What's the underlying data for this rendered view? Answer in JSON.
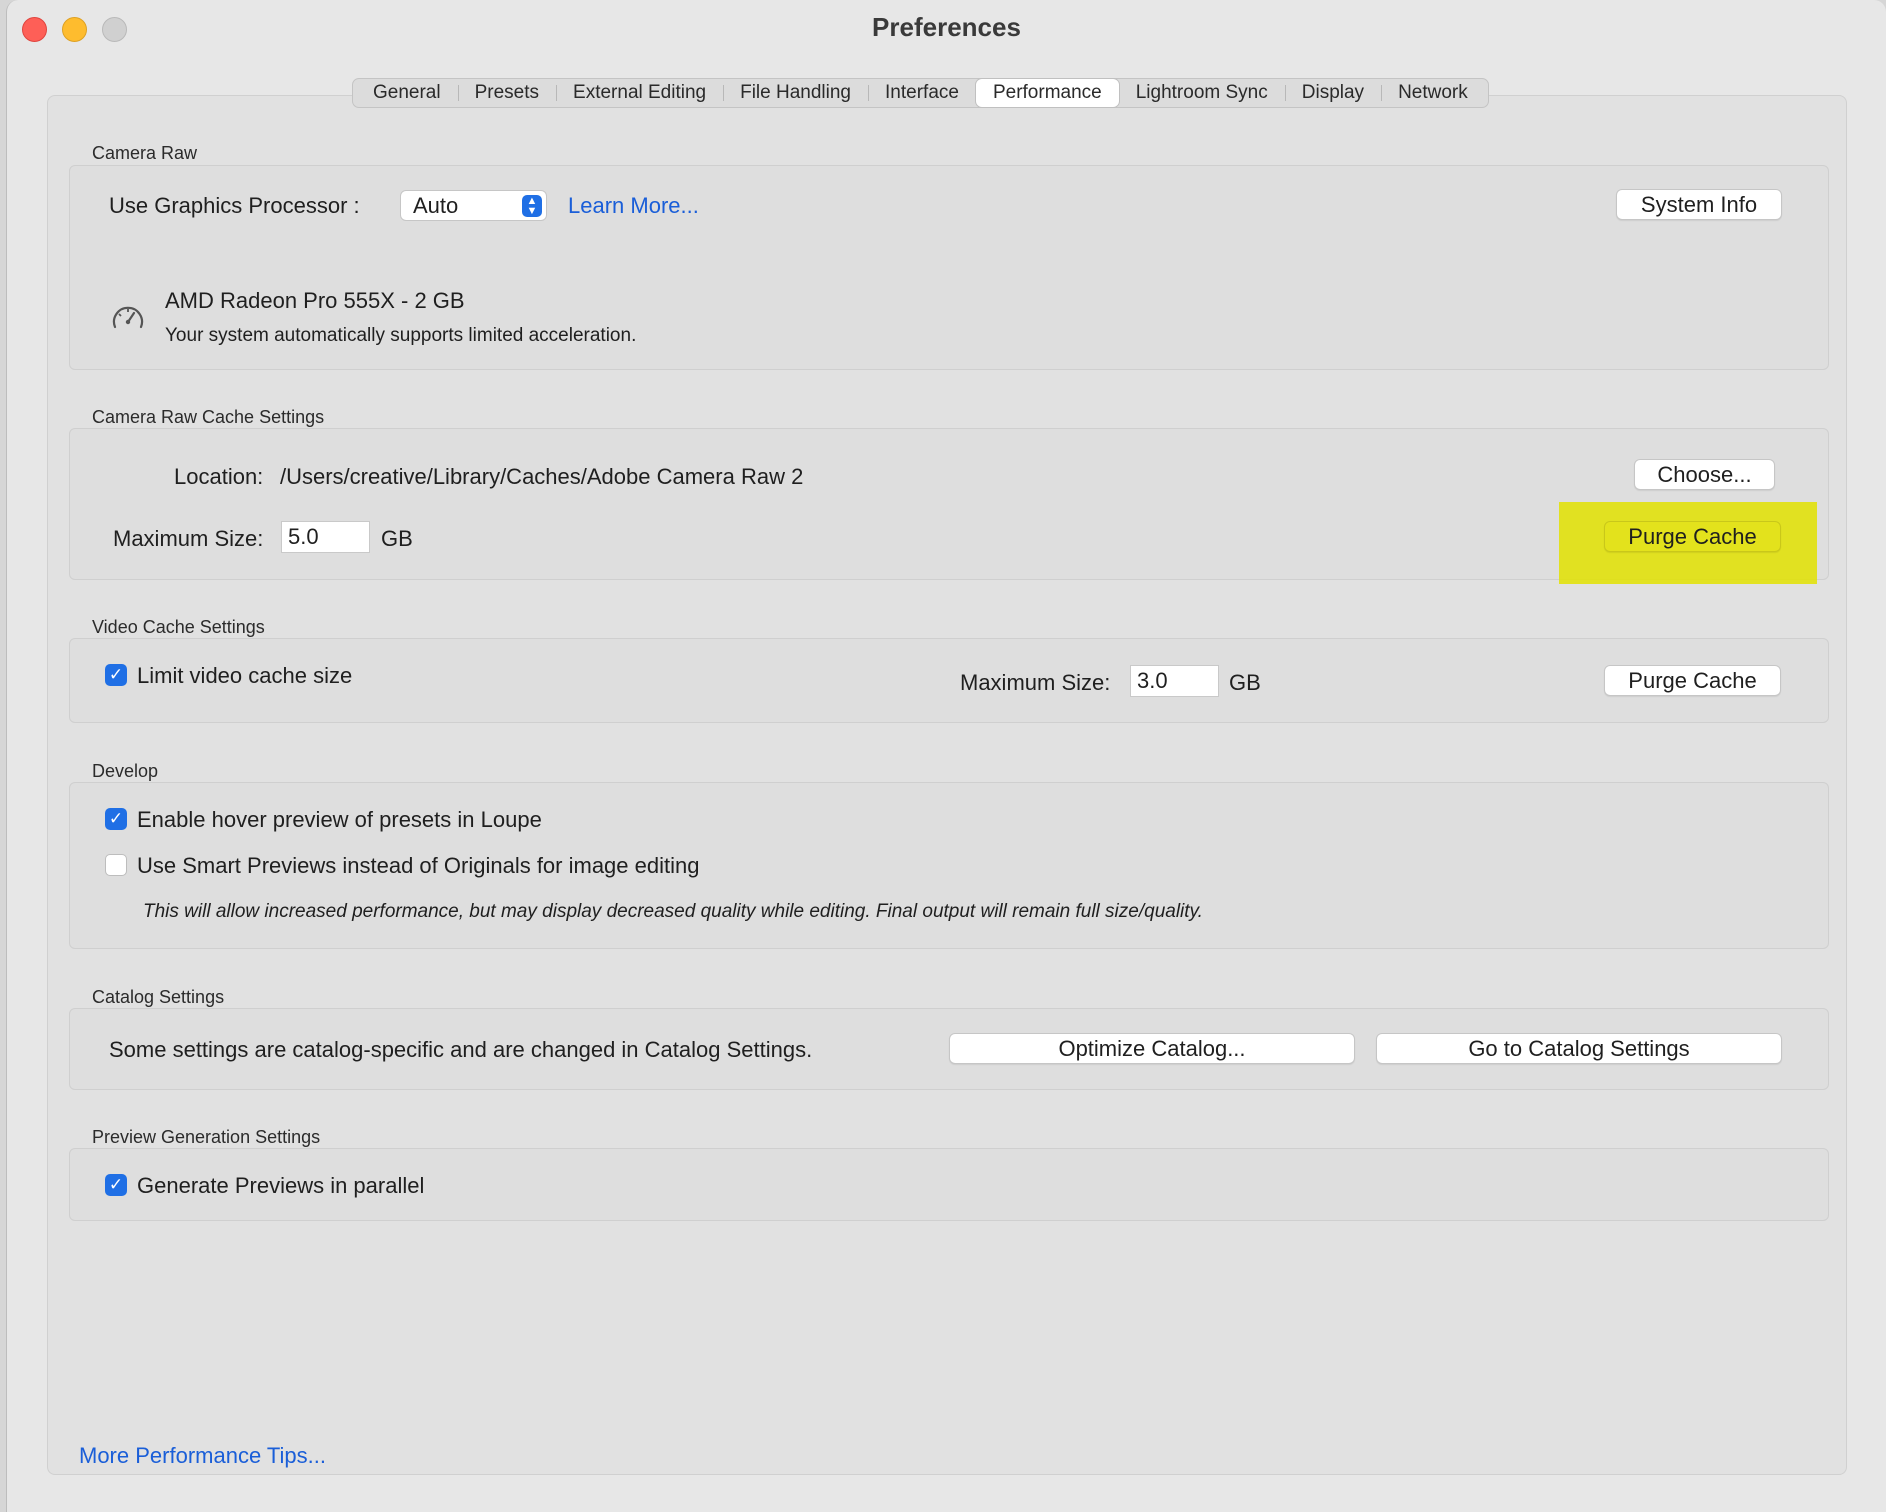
{
  "window": {
    "title": "Preferences"
  },
  "tabs": [
    {
      "label": "General"
    },
    {
      "label": "Presets"
    },
    {
      "label": "External Editing"
    },
    {
      "label": "File Handling"
    },
    {
      "label": "Interface"
    },
    {
      "label": "Performance",
      "active": true
    },
    {
      "label": "Lightroom Sync"
    },
    {
      "label": "Display"
    },
    {
      "label": "Network"
    }
  ],
  "camera_raw": {
    "section_label": "Camera Raw",
    "gpu_label": "Use Graphics Processor :",
    "gpu_value": "Auto",
    "learn_more": "Learn More...",
    "system_info_button": "System Info",
    "gpu_name": "AMD Radeon Pro 555X - 2 GB",
    "gpu_status": "Your system automatically supports limited acceleration."
  },
  "raw_cache": {
    "section_label": "Camera Raw Cache Settings",
    "location_label": "Location:",
    "location_value": "/Users/creative/Library/Caches/Adobe Camera Raw 2",
    "choose_button": "Choose...",
    "max_size_label": "Maximum Size:",
    "max_size_value": "5.0",
    "unit": "GB",
    "purge_button": "Purge Cache"
  },
  "video_cache": {
    "section_label": "Video Cache Settings",
    "limit_label": "Limit video cache size",
    "limit_checked": true,
    "max_size_label": "Maximum Size:",
    "max_size_value": "3.0",
    "unit": "GB",
    "purge_button": "Purge Cache"
  },
  "develop": {
    "section_label": "Develop",
    "hover_preview_label": "Enable hover preview of presets in Loupe",
    "hover_preview_checked": true,
    "smart_previews_label": "Use Smart Previews instead of Originals for image editing",
    "smart_previews_checked": false,
    "note": "This will allow increased performance, but may display decreased quality while editing. Final output will remain full size/quality."
  },
  "catalog": {
    "section_label": "Catalog Settings",
    "description": "Some settings are catalog-specific and are changed in Catalog Settings.",
    "optimize_button": "Optimize Catalog...",
    "goto_button": "Go to Catalog Settings"
  },
  "preview": {
    "section_label": "Preview Generation Settings",
    "parallel_label": "Generate Previews in parallel",
    "parallel_checked": true
  },
  "footer": {
    "tips_link": "More Performance Tips..."
  },
  "colors": {
    "accent": "#1f6fe5",
    "link": "#1a5ed8",
    "highlight": "#e3e21c"
  },
  "icons": {
    "gpu": "speedometer-icon",
    "checkmark": "checkmark-icon"
  }
}
